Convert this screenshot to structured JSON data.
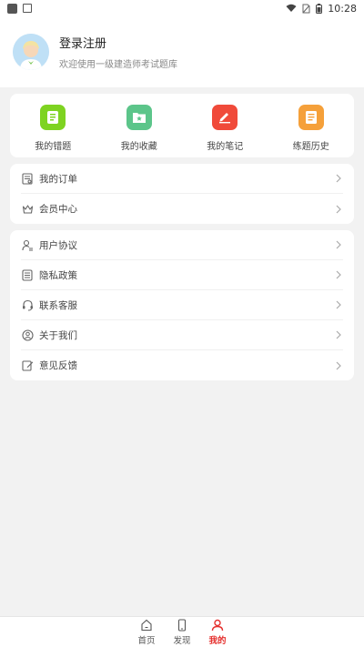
{
  "status_bar": {
    "time": "10:28"
  },
  "profile": {
    "title": "登录注册",
    "subtitle": "欢迎使用一级建造师考试题库"
  },
  "quick_grid": [
    {
      "label": "我的错题",
      "icon": "error-notebook-icon",
      "color": "#7ed321"
    },
    {
      "label": "我的收藏",
      "icon": "favorites-folder-icon",
      "color": "#5cc58a"
    },
    {
      "label": "我的笔记",
      "icon": "note-pen-icon",
      "color": "#f04a3a"
    },
    {
      "label": "练题历史",
      "icon": "history-doc-icon",
      "color": "#f5a03a"
    }
  ],
  "list_group_1": [
    {
      "label": "我的订单",
      "icon": "order-icon"
    },
    {
      "label": "会员中心",
      "icon": "crown-icon"
    }
  ],
  "list_group_2": [
    {
      "label": "用户协议",
      "icon": "user-agreement-icon"
    },
    {
      "label": "隐私政策",
      "icon": "privacy-list-icon"
    },
    {
      "label": "联系客服",
      "icon": "headset-icon"
    },
    {
      "label": "关于我们",
      "icon": "about-user-icon"
    },
    {
      "label": "意见反馈",
      "icon": "feedback-edit-icon"
    }
  ],
  "bottom_nav": [
    {
      "label": "首页",
      "icon": "home-icon",
      "active": false
    },
    {
      "label": "发现",
      "icon": "phone-icon",
      "active": false
    },
    {
      "label": "我的",
      "icon": "person-icon",
      "active": true
    }
  ],
  "colors": {
    "accent": "#e5312f"
  }
}
